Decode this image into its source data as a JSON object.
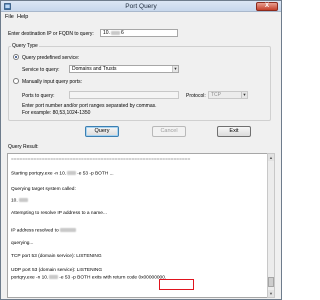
{
  "window": {
    "title": "Port Query",
    "close_label": "X"
  },
  "menu": {
    "items": [
      "File",
      "Help"
    ]
  },
  "destination": {
    "label": "Enter destination IP or FQDN to query:",
    "value_prefix": "10.",
    "value_suffix": "6"
  },
  "query_type": {
    "group_label": "Query Type",
    "predefined_label": "Query predefined service:",
    "service_label": "Service to query:",
    "service_value": "Domains and Trusts",
    "manual_label": "Manually input query ports:",
    "ports_label": "Ports to query:",
    "protocol_label": "Protocol:",
    "protocol_value": "TCP",
    "hint_line1": "Enter port number and/or port ranges separated by commas.",
    "hint_line2": "For example: 80,53,1024-1350"
  },
  "buttons": {
    "query": "Query",
    "cancel": "Cancel",
    "exit": "Exit"
  },
  "results": {
    "label": "Query Result:",
    "lines": [
      "================================================================",
      "Starting portqry.exe -n 10.",
      "-e 53 -p BOTH ...",
      "Querying target system called:",
      "10.",
      "Attempting to resolve IP address to a name...",
      "IP address resolved to",
      "querying...",
      "TCP port 53 (domain service): LISTENING",
      "UDP port 53 (domain service): LISTENING",
      "portqry.exe -n 10.",
      "-e 53 -p BOTH exits with return code",
      "0x00000000."
    ]
  }
}
